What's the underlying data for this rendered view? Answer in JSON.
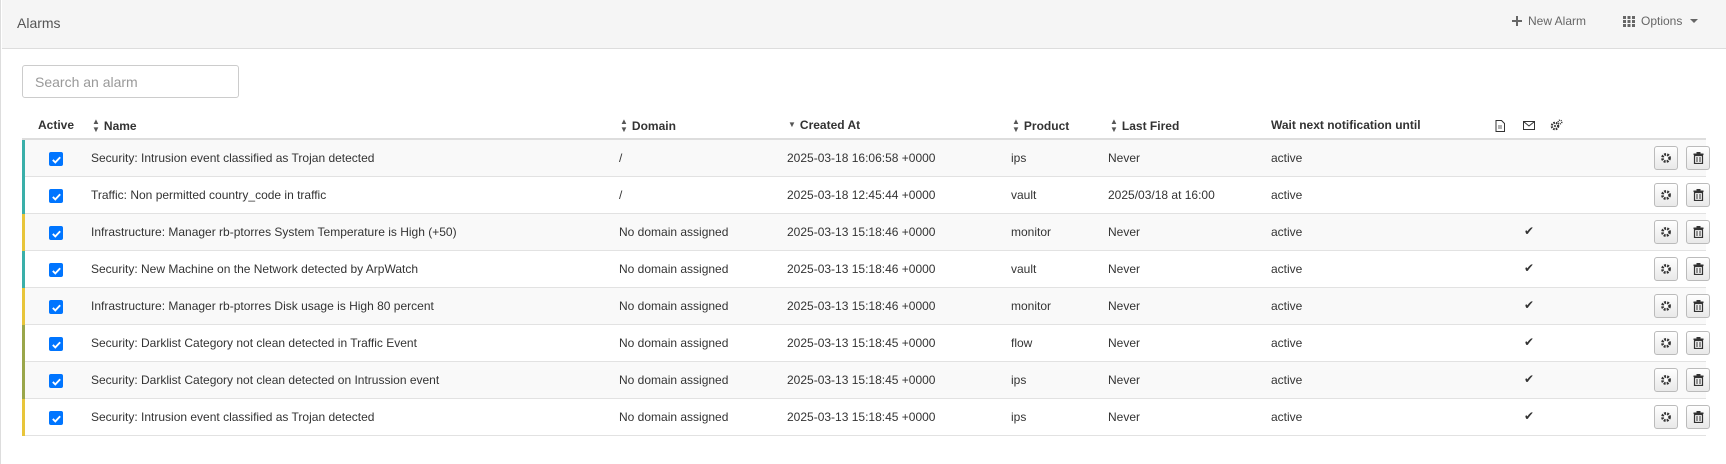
{
  "header": {
    "title": "Alarms",
    "new_alarm_label": "New Alarm",
    "options_label": "Options"
  },
  "search": {
    "placeholder": "Search an alarm",
    "value": ""
  },
  "columns": {
    "active": "Active",
    "name": "Name",
    "domain": "Domain",
    "created_at": "Created At",
    "product": "Product",
    "last_fired": "Last Fired",
    "wait": "Wait next notification until"
  },
  "colors": {
    "teal": "#3aafa9",
    "yellow": "#e8c53a",
    "olive": "#9aa64a",
    "checkbox": "#0075ff"
  },
  "rows": [
    {
      "name": "Security: Intrusion event classified as Trojan detected",
      "domain": "/",
      "created_at": "2025-03-18 16:06:58 +0000",
      "product": "ips",
      "last_fired": "Never",
      "wait": "active",
      "email_check": "",
      "color": "#3aafa9",
      "active": true
    },
    {
      "name": "Traffic: Non permitted country_code in traffic",
      "domain": "/",
      "created_at": "2025-03-18 12:45:44 +0000",
      "product": "vault",
      "last_fired": "2025/03/18 at 16:00",
      "wait": "active",
      "email_check": "",
      "color": "#3aafa9",
      "active": true
    },
    {
      "name": "Infrastructure: Manager rb-ptorres System Temperature is High (+50)",
      "domain": "No domain assigned",
      "created_at": "2025-03-13 15:18:46 +0000",
      "product": "monitor",
      "last_fired": "Never",
      "wait": "active",
      "email_check": "✔",
      "color": "#e8c53a",
      "active": true
    },
    {
      "name": "Security: New Machine on the Network detected by ArpWatch",
      "domain": "No domain assigned",
      "created_at": "2025-03-13 15:18:46 +0000",
      "product": "vault",
      "last_fired": "Never",
      "wait": "active",
      "email_check": "✔",
      "color": "#3aafa9",
      "active": true
    },
    {
      "name": "Infrastructure: Manager rb-ptorres Disk usage is High 80 percent",
      "domain": "No domain assigned",
      "created_at": "2025-03-13 15:18:46 +0000",
      "product": "monitor",
      "last_fired": "Never",
      "wait": "active",
      "email_check": "✔",
      "color": "#e8c53a",
      "active": true
    },
    {
      "name": "Security: Darklist Category not clean detected in Traffic Event",
      "domain": "No domain assigned",
      "created_at": "2025-03-13 15:18:45 +0000",
      "product": "flow",
      "last_fired": "Never",
      "wait": "active",
      "email_check": "✔",
      "color": "#9aa64a",
      "active": true
    },
    {
      "name": "Security: Darklist Category not clean detected on Intrussion event",
      "domain": "No domain assigned",
      "created_at": "2025-03-13 15:18:45 +0000",
      "product": "ips",
      "last_fired": "Never",
      "wait": "active",
      "email_check": "✔",
      "color": "#9aa64a",
      "active": true
    },
    {
      "name": "Security: Intrusion event classified as Trojan detected",
      "domain": "No domain assigned",
      "created_at": "2025-03-13 15:18:45 +0000",
      "product": "ips",
      "last_fired": "Never",
      "wait": "active",
      "email_check": "✔",
      "color": "#e8c53a",
      "active": true
    }
  ]
}
